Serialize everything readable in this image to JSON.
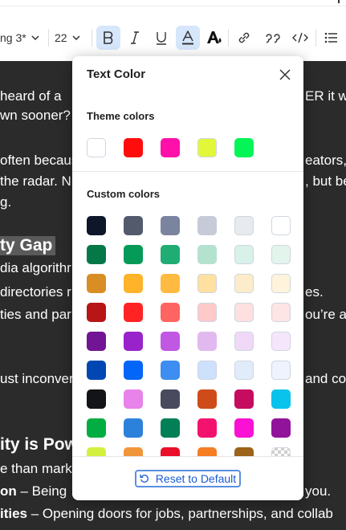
{
  "toolbar": {
    "style_value": "ng 3*",
    "size_value": "22"
  },
  "document": {
    "lines": [
      {
        "text": " heard of a",
        "right": "ER it wa"
      },
      {
        "text": "wn sooner?",
        "right": ""
      },
      {
        "text": "often becaus",
        "right": "eators,"
      },
      {
        "text": "the radar. N",
        "right": ", but be"
      },
      {
        "text": "g.",
        "right": ""
      },
      {
        "text": "dia algorithr",
        "right": ""
      },
      {
        "text": "directories r",
        "right": "es."
      },
      {
        "text": "ties and par",
        "right": "ou’re a"
      },
      {
        "text": "ust inconver",
        "right": "and co"
      },
      {
        "text": "e than mark",
        "right": ""
      }
    ],
    "heading1": "ty Gap",
    "heading2": "ity is Pow",
    "bold_line1": {
      "bold": "on",
      "rest": " – Being ",
      "right": " you."
    },
    "bold_line2": {
      "bold": "ities",
      "rest": " – Opening doors for jobs, partnerships, and collab"
    }
  },
  "popup": {
    "title": "Text Color",
    "theme_title": "Theme colors",
    "custom_title": "Custom colors",
    "reset_label": "Reset to Default",
    "theme_colors": [
      "#ffffff",
      "#ff0d0d",
      "#ff10ab",
      "#e3f73a",
      "#05f557"
    ],
    "custom_colors": [
      [
        "#0e1629",
        "#535a6c",
        "#7b849f",
        "#c7cbd8",
        "#e7eaef",
        "#ffffff"
      ],
      [
        "#05784a",
        "#069a59",
        "#20ad74",
        "#b4e2cf",
        "#d8f1e9",
        "#e3f4ed"
      ],
      [
        "#d88e25",
        "#ffb32a",
        "#ffbb41",
        "#ffe0a1",
        "#fdecc9",
        "#fff3dc"
      ],
      [
        "#b71516",
        "#ff2323",
        "#fe6461",
        "#fec9c8",
        "#fde0df",
        "#fde4e5"
      ],
      [
        "#721594",
        "#9823cb",
        "#c058e3",
        "#e1b9ef",
        "#f0d9f6",
        "#f6e6fb"
      ],
      [
        "#0147b4",
        "#0466f8",
        "#3d8ef0",
        "#cde0fc",
        "#e1ecfb",
        "#eef3fd"
      ],
      [
        "#121417",
        "#e883eb",
        "#4a4a5e",
        "#cf4b19",
        "#c60c5e",
        "#0ac3ec"
      ],
      [
        "#02ad41",
        "#2c82db",
        "#037f57",
        "#f3136f",
        "#f912d3",
        "#91139b"
      ],
      [
        "#d4f03e",
        "#f1953b",
        "#ea0e2a",
        "#f57d22",
        "#9b6419",
        "transparent"
      ]
    ]
  }
}
